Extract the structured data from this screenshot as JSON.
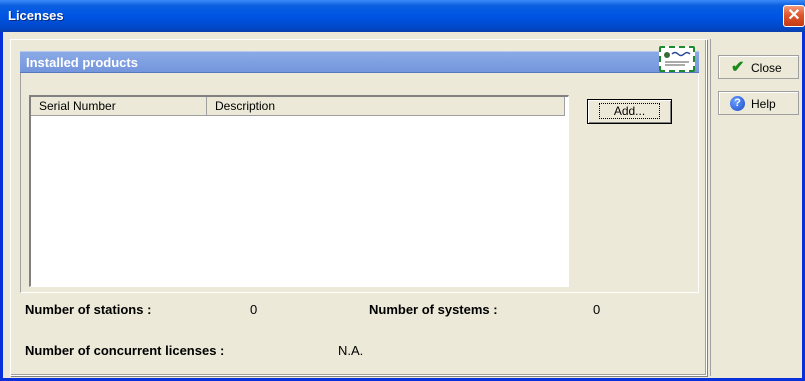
{
  "window": {
    "title": "Licenses",
    "close_glyph": "✕"
  },
  "group": {
    "title": "Installed products",
    "icon": "certificate-icon"
  },
  "table": {
    "columns": [
      "Serial Number",
      "Description"
    ],
    "rows": []
  },
  "buttons": {
    "add": "Add...",
    "close": "Close",
    "help": "Help"
  },
  "stats": {
    "stations_label": "Number of stations :",
    "stations_value": "0",
    "systems_label": "Number of systems :",
    "systems_value": "0",
    "concurrent_label": "Number of concurrent licenses  :",
    "concurrent_value": "N.A."
  },
  "colors": {
    "title_bar": "#0055e5",
    "group_header": "#7b9be0",
    "close_button": "#e0552b",
    "check_green": "#1a8a1a"
  }
}
